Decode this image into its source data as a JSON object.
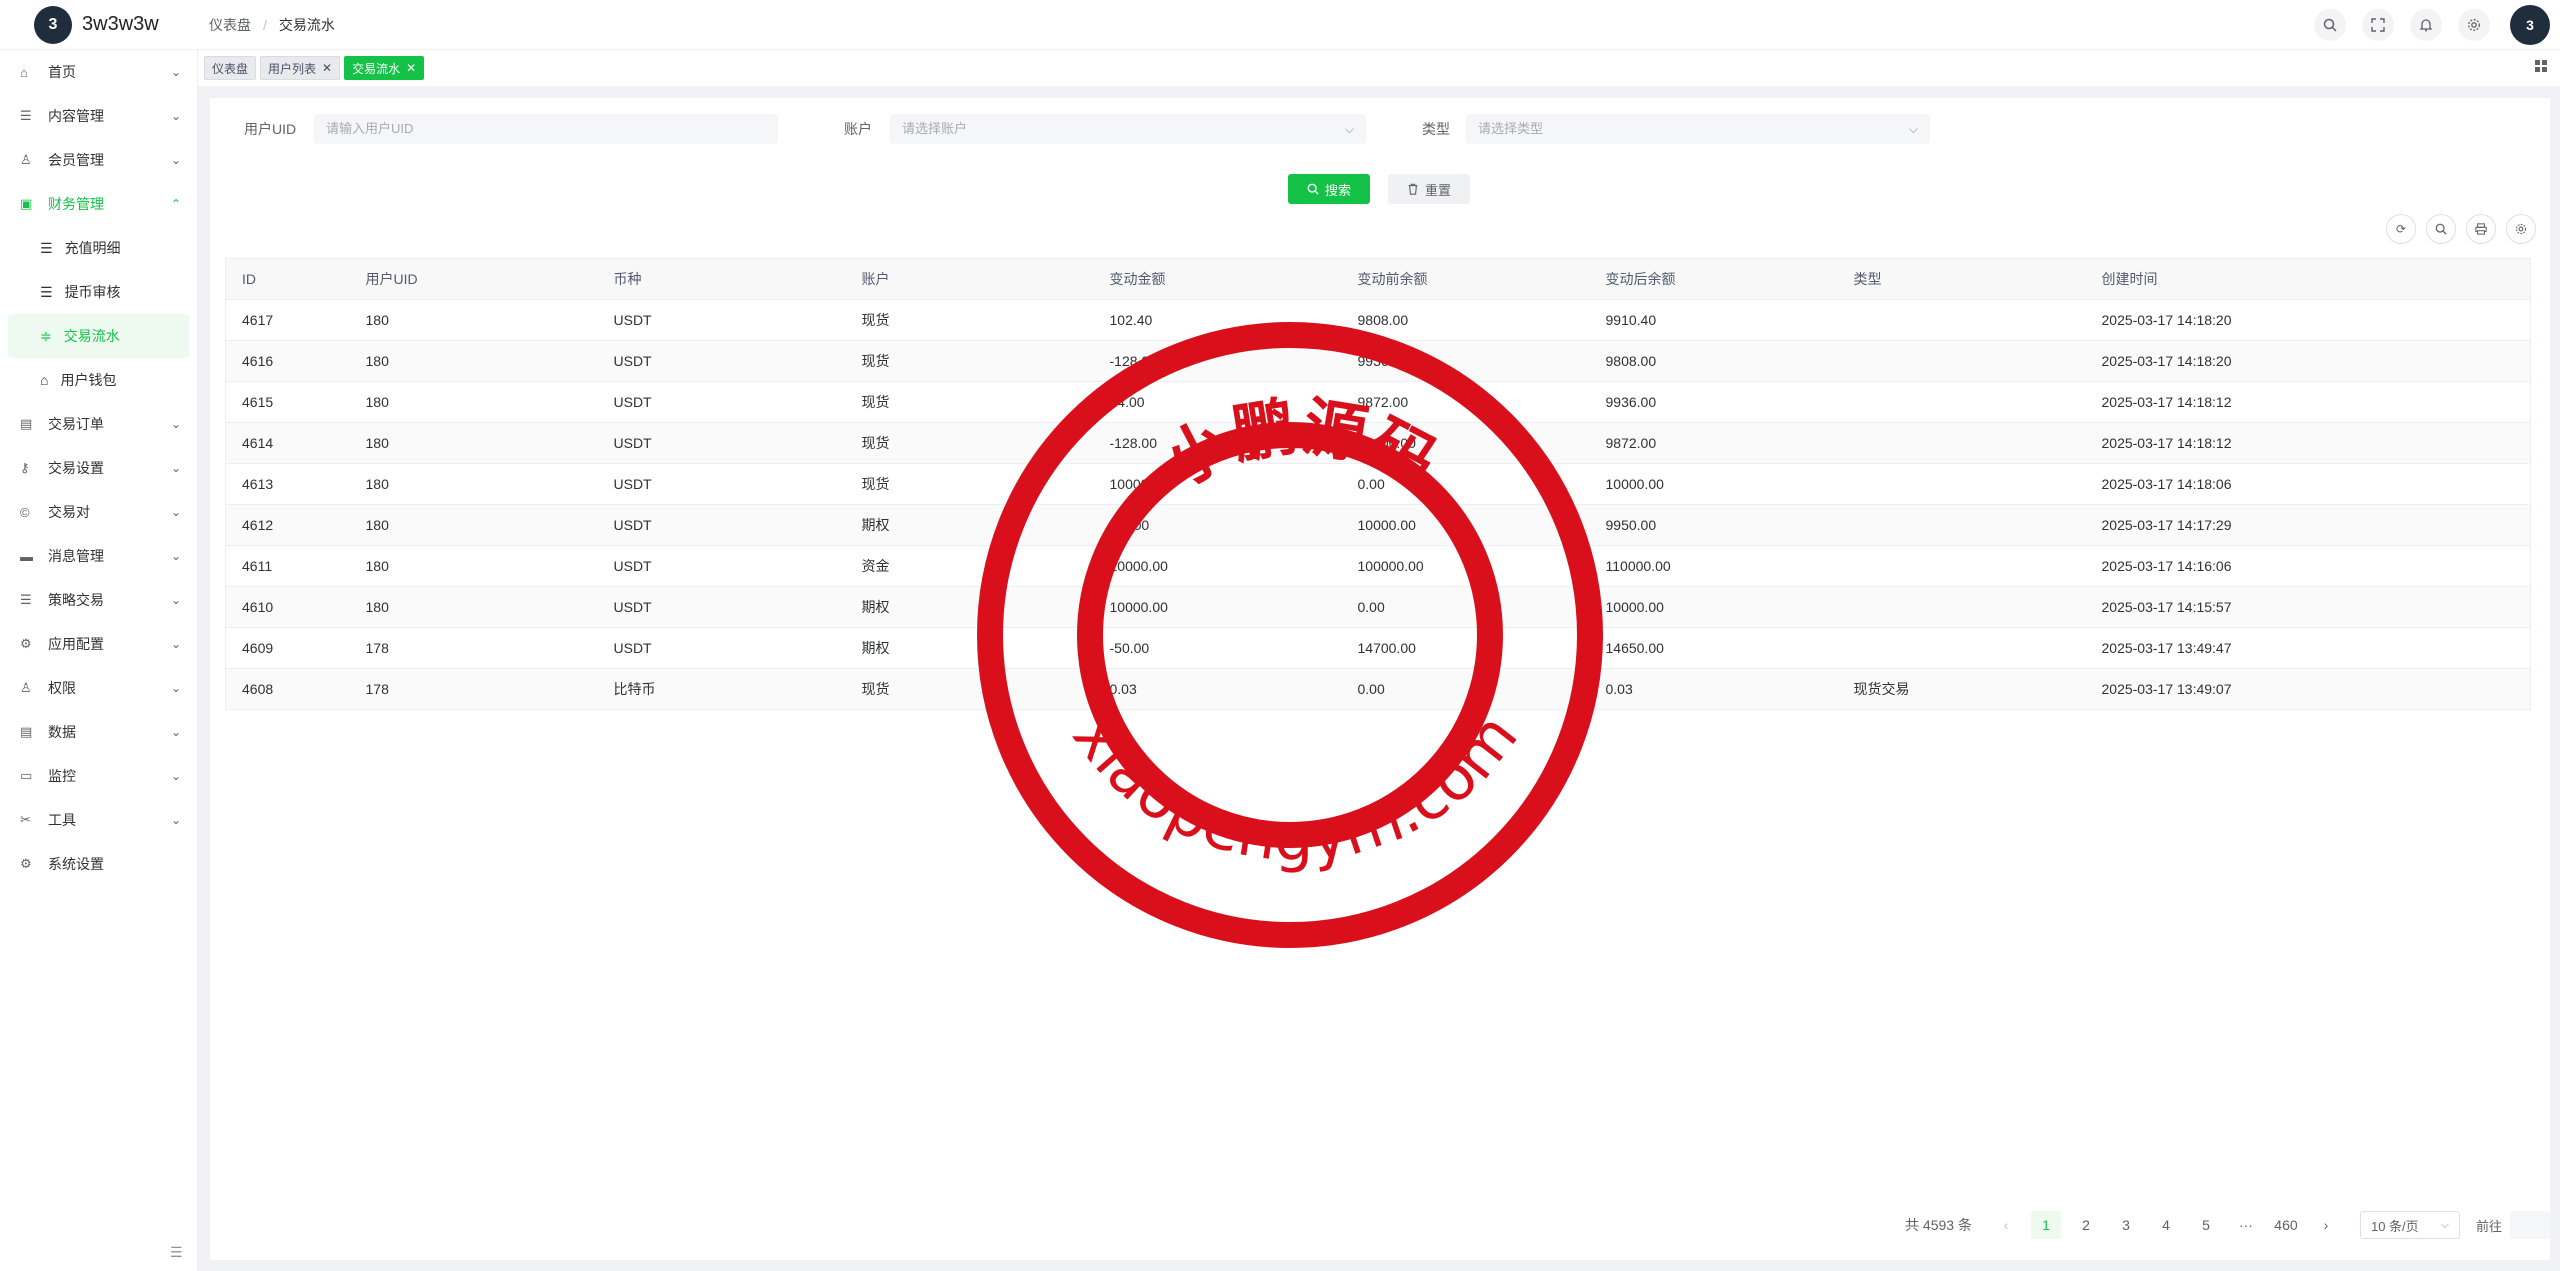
{
  "app": {
    "logo_mark": "3",
    "title": "3w3w3w"
  },
  "breadcrumb": [
    "仪表盘",
    "交易流水"
  ],
  "top_actions": [
    "search-icon",
    "fullscreen-icon",
    "bell-icon",
    "gear-icon"
  ],
  "sidebar": {
    "items": [
      {
        "label": "首页",
        "icon": "home-icon"
      },
      {
        "label": "内容管理",
        "icon": "list-icon"
      },
      {
        "label": "会员管理",
        "icon": "user-icon"
      },
      {
        "label": "财务管理",
        "icon": "finance-icon",
        "open": true,
        "children": [
          {
            "label": "充值明细",
            "icon": "list-icon"
          },
          {
            "label": "提币审核",
            "icon": "list-icon"
          },
          {
            "label": "交易流水",
            "icon": "filter-icon",
            "active": true
          },
          {
            "label": "用户钱包",
            "icon": "home-icon"
          }
        ]
      },
      {
        "label": "交易订单",
        "icon": "table-icon"
      },
      {
        "label": "交易设置",
        "icon": "key-icon"
      },
      {
        "label": "交易对",
        "icon": "copyright-icon"
      },
      {
        "label": "消息管理",
        "icon": "message-icon"
      },
      {
        "label": "策略交易",
        "icon": "list-icon"
      },
      {
        "label": "应用配置",
        "icon": "puzzle-icon"
      },
      {
        "label": "权限",
        "icon": "permission-icon"
      },
      {
        "label": "数据",
        "icon": "data-icon"
      },
      {
        "label": "监控",
        "icon": "monitor-icon"
      },
      {
        "label": "工具",
        "icon": "tool-icon"
      },
      {
        "label": "系统设置",
        "icon": "gear-icon"
      }
    ]
  },
  "tabs": [
    {
      "label": "仪表盘",
      "closable": false
    },
    {
      "label": "用户列表",
      "closable": true
    },
    {
      "label": "交易流水",
      "closable": true,
      "active": true
    }
  ],
  "filters": {
    "uid_label": "用户UID",
    "uid_placeholder": "请输入用户UID",
    "account_label": "账户",
    "account_placeholder": "请选择账户",
    "type_label": "类型",
    "type_placeholder": "请选择类型",
    "search_label": "搜索",
    "reset_label": "重置"
  },
  "table": {
    "columns": [
      "ID",
      "用户UID",
      "币种",
      "账户",
      "变动金额",
      "变动前余额",
      "变动后余额",
      "类型",
      "创建时间"
    ],
    "rows": [
      [
        "4617",
        "180",
        "USDT",
        "现货",
        "102.40",
        "9808.00",
        "9910.40",
        "",
        "2025-03-17 14:18:20"
      ],
      [
        "4616",
        "180",
        "USDT",
        "现货",
        "-128.00",
        "9936.00",
        "9808.00",
        "",
        "2025-03-17 14:18:20"
      ],
      [
        "4615",
        "180",
        "USDT",
        "现货",
        "64.00",
        "9872.00",
        "9936.00",
        "",
        "2025-03-17 14:18:12"
      ],
      [
        "4614",
        "180",
        "USDT",
        "现货",
        "-128.00",
        "10000.00",
        "9872.00",
        "",
        "2025-03-17 14:18:12"
      ],
      [
        "4613",
        "180",
        "USDT",
        "现货",
        "10000.00",
        "0.00",
        "10000.00",
        "",
        "2025-03-17 14:18:06"
      ],
      [
        "4612",
        "180",
        "USDT",
        "期权",
        "-50.00",
        "10000.00",
        "9950.00",
        "",
        "2025-03-17 14:17:29"
      ],
      [
        "4611",
        "180",
        "USDT",
        "资金",
        "10000.00",
        "100000.00",
        "110000.00",
        "",
        "2025-03-17 14:16:06"
      ],
      [
        "4610",
        "180",
        "USDT",
        "期权",
        "10000.00",
        "0.00",
        "10000.00",
        "",
        "2025-03-17 14:15:57"
      ],
      [
        "4609",
        "178",
        "USDT",
        "期权",
        "-50.00",
        "14700.00",
        "14650.00",
        "",
        "2025-03-17 13:49:47"
      ],
      [
        "4608",
        "178",
        "比特币",
        "现货",
        "0.03",
        "0.00",
        "0.03",
        "现货交易",
        "2025-03-17 13:49:07"
      ]
    ]
  },
  "pagination": {
    "total_text": "共 4593 条",
    "pages": [
      "1",
      "2",
      "3",
      "4",
      "5",
      "···",
      "460"
    ],
    "current": "1",
    "page_size": "10 条/页",
    "jump_label": "前往"
  },
  "watermark": {
    "top_text": "小鹏源码",
    "bottom_text": "xiaopengym.com",
    "color": "#d9101b"
  },
  "colors": {
    "accent": "#13c247"
  }
}
